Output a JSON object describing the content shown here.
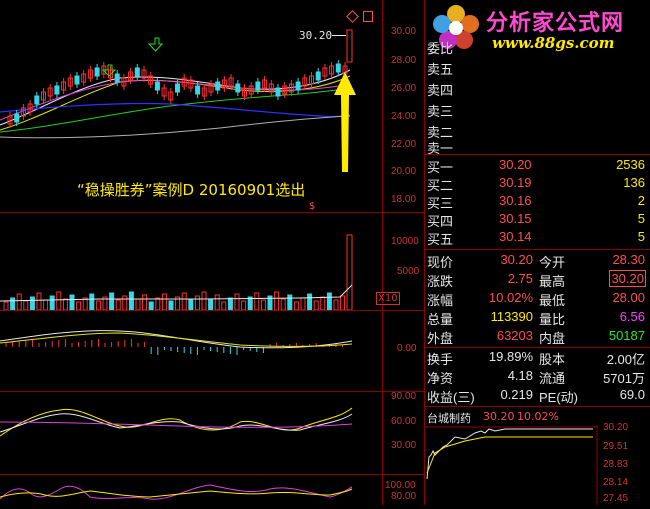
{
  "logo": {
    "title": "分析家公式网",
    "url": "www.88gs.com"
  },
  "chart_main": {
    "price_label": "30.20",
    "y_ticks": [
      "30.00",
      "28.00",
      "26.00",
      "24.00",
      "22.00",
      "20.00",
      "18.00"
    ],
    "annotation": "“稳操胜券”案例D 20160901选出",
    "dollar_mark": "$"
  },
  "volume": {
    "y_ticks": [
      "10000",
      "5000"
    ],
    "unit_label": "X10"
  },
  "macd": {
    "y_ticks": [
      "0.00"
    ]
  },
  "kdj": {
    "y_ticks": [
      "90.00",
      "60.00",
      "30.00"
    ]
  },
  "rsi": {
    "y_ticks": [
      "100.00",
      "80.00"
    ]
  },
  "order_book": {
    "weibi_label": "委比",
    "sells": [
      "卖五",
      "卖四",
      "卖三",
      "卖二",
      "卖一"
    ],
    "buys": [
      {
        "label": "买一",
        "price": "30.20",
        "vol": "2536"
      },
      {
        "label": "买二",
        "price": "30.19",
        "vol": "136"
      },
      {
        "label": "买三",
        "price": "30.16",
        "vol": "2"
      },
      {
        "label": "买四",
        "price": "30.15",
        "vol": "5"
      },
      {
        "label": "买五",
        "price": "30.14",
        "vol": "5"
      }
    ]
  },
  "quote": {
    "rows": [
      {
        "l1": "现价",
        "v1": "30.20",
        "l2": "今开",
        "v2": "28.30"
      },
      {
        "l1": "涨跌",
        "v1": "2.75",
        "l2": "最高",
        "v2": "30.20"
      },
      {
        "l1": "涨幅",
        "v1": "10.02%",
        "l2": "最低",
        "v2": "28.00"
      },
      {
        "l1": "总量",
        "v1": "113390",
        "l2": "量比",
        "v2": "6.56"
      },
      {
        "l1": "外盘",
        "v1": "63203",
        "l2": "内盘",
        "v2": "50187"
      }
    ],
    "rows2": [
      {
        "l1": "换手",
        "v1": "19.89%",
        "l2": "股本",
        "v2": "2.00亿"
      },
      {
        "l1": "净资",
        "v1": "4.18",
        "l2": "流通",
        "v2": "5701万"
      },
      {
        "l1": "收益(三)",
        "v1": "0.219",
        "l2": "PE(动)",
        "v2": "69.0"
      }
    ]
  },
  "mini_chart": {
    "name": "台城制药",
    "price": "30.20",
    "pct": "10.02%",
    "y_ticks": [
      "30.20",
      "29.51",
      "28.83",
      "28.14",
      "27.45"
    ]
  },
  "colors": {
    "grid": "#8b0000",
    "up": "#ff3030",
    "down": "#36d6e7",
    "accent": "#ffea00"
  }
}
